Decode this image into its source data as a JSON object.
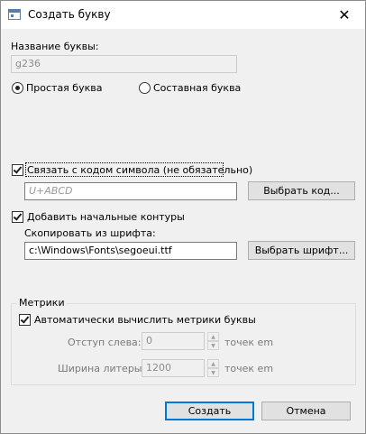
{
  "window": {
    "title": "Создать букву",
    "close_glyph": "✕"
  },
  "name": {
    "label": "Название буквы:",
    "value": "g236"
  },
  "type": {
    "simple_label": "Простая буква",
    "composite_label": "Составная буква"
  },
  "link": {
    "label": "Связать с кодом символа (не обязательно)",
    "placeholder": "U+ABCD",
    "select_button": "Выбрать код..."
  },
  "contours": {
    "label": "Добавить начальные контуры",
    "copy_label": "Скопировать из шрифта:",
    "path": "c:\\Windows\\Fonts\\segoeui.ttf",
    "select_button": "Выбрать шрифт..."
  },
  "metrics": {
    "group_label": "Метрики",
    "auto_label": "Автоматически вычислить метрики буквы",
    "left_label": "Отступ слева:",
    "left_value": "0",
    "width_label": "Ширина литеры:",
    "width_value": "1200",
    "unit": "точек em",
    "spin_up": "▲",
    "spin_down": "▼"
  },
  "buttons": {
    "create": "Создать",
    "cancel": "Отмена"
  }
}
